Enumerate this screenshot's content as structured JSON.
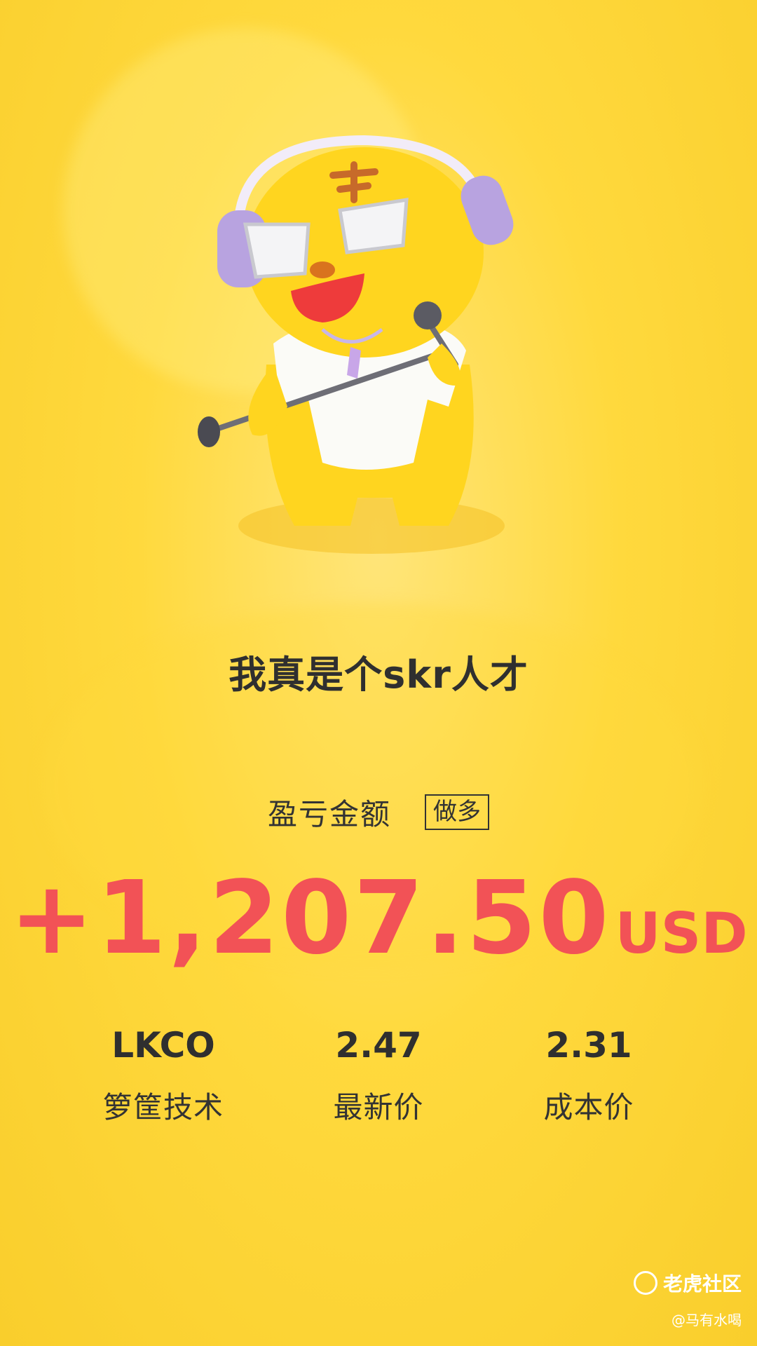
{
  "slogan": "我真是个skr人才",
  "pnl": {
    "label": "盈亏金额",
    "direction_tag": "做多",
    "amount": "+1,207.50",
    "currency": "USD",
    "color": "#F25256"
  },
  "stats": [
    {
      "value": "LKCO",
      "label": "箩筐技术"
    },
    {
      "value": "2.47",
      "label": "最新价"
    },
    {
      "value": "2.31",
      "label": "成本价"
    }
  ],
  "watermark": {
    "brand": "老虎社区",
    "user": "@马有水喝"
  },
  "colors": {
    "background": "#FFD93D",
    "accent": "#F25256",
    "text": "#2f2f2f"
  }
}
